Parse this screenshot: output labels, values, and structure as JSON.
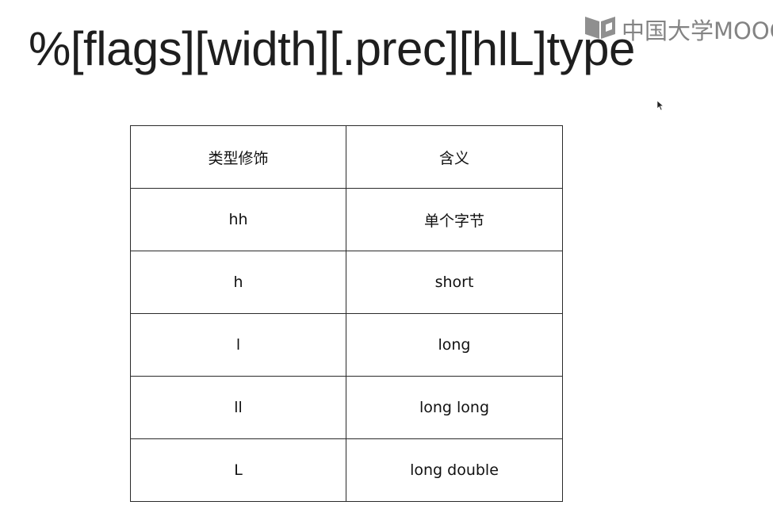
{
  "slide": {
    "title": "%[flags][width][.prec][hlL]type",
    "watermark": "中国大学MOOC"
  },
  "table": {
    "headers": [
      "类型修饰",
      "含义"
    ],
    "rows": [
      [
        "hh",
        "单个字节"
      ],
      [
        "h",
        "short"
      ],
      [
        "l",
        "long"
      ],
      [
        "ll",
        "long long"
      ],
      [
        "L",
        "long double"
      ]
    ]
  },
  "colors": {
    "text": "#1e1e1e",
    "border": "#2a2a2a",
    "watermark": "#5a5a5a"
  }
}
